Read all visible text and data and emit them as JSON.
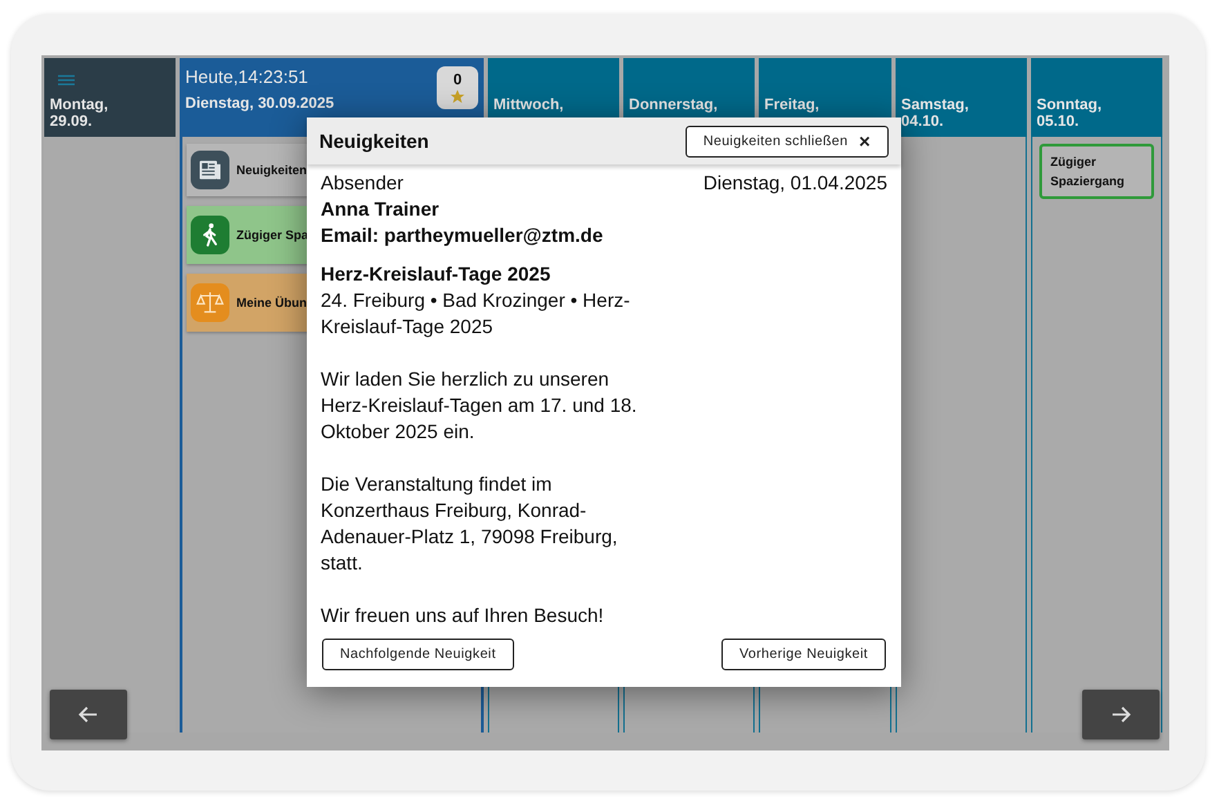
{
  "days": [
    {
      "kind": "past",
      "name": "Montag,",
      "date": "29.09."
    },
    {
      "kind": "today",
      "now": "Heute,14:23:51",
      "name": "Dienstag, 30.09.2025",
      "badge": "0",
      "cards": [
        {
          "kind": "news",
          "label": "Neuigkeiten"
        },
        {
          "kind": "walk",
          "label": "Zügiger Spa"
        },
        {
          "kind": "balance",
          "label": "Meine Übun"
        }
      ]
    },
    {
      "kind": "future",
      "name": "Mittwoch,"
    },
    {
      "kind": "future",
      "name": "Donnerstag,"
    },
    {
      "kind": "future",
      "name": "Freitag,"
    },
    {
      "kind": "future",
      "name": "Samstag,",
      "date": "04.10."
    },
    {
      "kind": "future",
      "name": "Sonntag,",
      "date": "05.10.",
      "cards": [
        {
          "kind": "outlined",
          "label": "Zügiger Spaziergang"
        }
      ]
    }
  ],
  "dialog": {
    "title": "Neuigkeiten",
    "close": "Neuigkeiten schließen",
    "close_icon": "×",
    "sender_label": "Absender",
    "date": "Dienstag, 01.04.2025",
    "sender": "Anna Trainer",
    "email": "Email: partheymueller@ztm.de",
    "headline": "Herz-Kreislauf-Tage 2025",
    "paragraphs": [
      "24. Freiburg • Bad Krozinger • Herz-Kreislauf-Tage 2025",
      "Wir laden Sie herzlich zu unseren Herz-Kreislauf-Tagen am 17. und 18. Oktober 2025 ein.",
      "Die Veranstaltung findet im Konzerthaus Freiburg, Konrad-Adenauer-Platz 1, 79098 Freiburg, statt.",
      "Wir freuen uns auf Ihren Besuch!"
    ],
    "next": "Nachfolgende Neuigkeit",
    "previous": "Vorherige Neuigkeit"
  }
}
